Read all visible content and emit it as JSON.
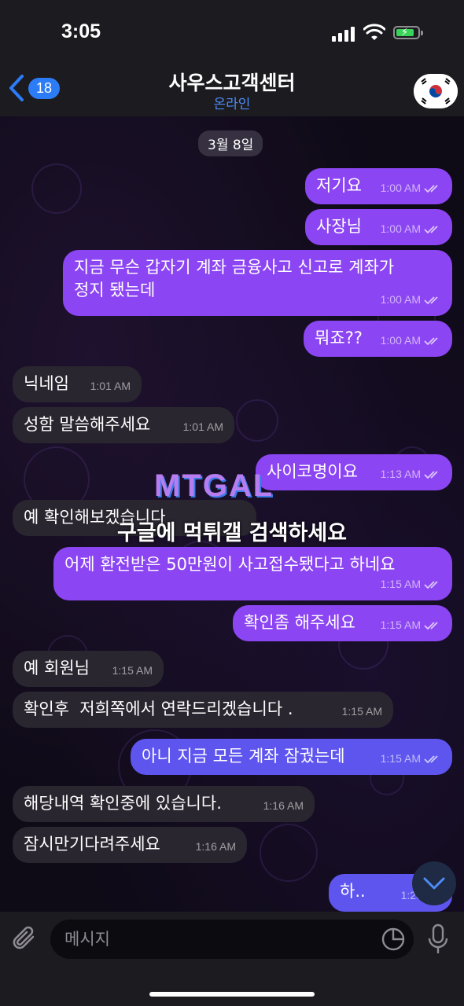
{
  "status_bar": {
    "time": "3:05"
  },
  "header": {
    "back_count": "18",
    "title": "사우스고객센터",
    "subtitle": "온라인"
  },
  "date_chip": "3월 8일",
  "messages": [
    {
      "dir": "out",
      "text": "저기요",
      "time": "1:00 AM"
    },
    {
      "dir": "out",
      "text": "사장님",
      "time": "1:00 AM"
    },
    {
      "dir": "out",
      "text": "지금 무슨 갑자기 계좌 금융사고 신고로 계좌가\n정지 됐는데",
      "time": "1:00 AM"
    },
    {
      "dir": "out",
      "text": "뭐죠??",
      "time": "1:00 AM"
    },
    {
      "dir": "in",
      "text": "닉네임",
      "time": "1:01 AM"
    },
    {
      "dir": "in",
      "text": "성함 말씀해주세요",
      "time": "1:01 AM"
    },
    {
      "dir": "out",
      "text": "사이코명이요",
      "time": "1:13 AM"
    },
    {
      "dir": "in",
      "text": "예 확인해보겠습니다",
      "time": ""
    },
    {
      "dir": "out",
      "text": "어제 환전받은 50만원이 사고접수됐다고 하네요",
      "time": "1:15 AM"
    },
    {
      "dir": "out",
      "text": "확인좀 해주세요",
      "time": "1:15 AM"
    },
    {
      "dir": "in",
      "text": "예 회원님",
      "time": "1:15 AM"
    },
    {
      "dir": "in",
      "text": "확인후  저희쪽에서 연락드리겠습니다 .",
      "time": "1:15 AM"
    },
    {
      "dir": "out",
      "text": "아니 지금 모든 계좌 잠궜는데",
      "time": "1:15 AM"
    },
    {
      "dir": "in",
      "text": "해당내역 확인중에 있습니다.",
      "time": "1:16 AM"
    },
    {
      "dir": "in",
      "text": "잠시만기다려주세요",
      "time": "1:16 AM"
    },
    {
      "dir": "out",
      "text": "하..",
      "time": "1:23 AM"
    }
  ],
  "watermark": {
    "logo": "MTGAL",
    "text": "구글에 먹튀갤 검색하세요"
  },
  "input": {
    "placeholder": "메시지"
  },
  "colors": {
    "outgoing": "#8c45f2",
    "outgoing_bottom": "#5e55ef",
    "incoming": "#2a2630",
    "accent": "#2b7cf6"
  }
}
